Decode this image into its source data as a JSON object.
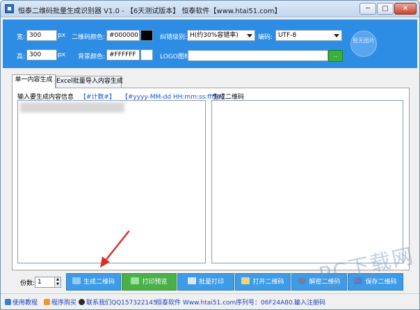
{
  "window": {
    "title": "恒泰二维码批量生成识别器 V1.0 - 【6天测试版本】 恒泰软件【www.htai51.com】",
    "min_symbol": "─",
    "max_symbol": "□",
    "close_symbol": "✕"
  },
  "settings": {
    "width_label": "宽:",
    "width_value": "300",
    "width_unit": "px",
    "height_label": "高:",
    "height_value": "300",
    "height_unit": "px",
    "qr_color_label": "二维码颜色:",
    "qr_color_value": "#000000",
    "qr_color_swatch": "#000000",
    "bg_color_label": "背景颜色:",
    "bg_color_value": "#FFFFFF",
    "bg_color_swatch": "#FFFFFF",
    "error_level_label": "纠错级别:",
    "error_level_value": "H(约30%容错率)",
    "encoding_label": "编码:",
    "encoding_value": "UTF-8",
    "logo_label": "LOGO图标:",
    "logo_value": "",
    "logo_button": "..",
    "logo_preview_text": "暂无图片"
  },
  "tabs": [
    {
      "label": "单一内容生成",
      "active": true
    },
    {
      "label": "Excel批量导入内容生成",
      "active": false
    }
  ],
  "input_panel": {
    "title": "输入要生成内容信息",
    "insert_counter": "【#计数#】",
    "insert_datetime": "【#yyyy-MM-dd HH:mm:ss:ffff#】",
    "text": ""
  },
  "output_panel": {
    "title": "生成二维码"
  },
  "toolbar": {
    "copies_label": "份数:",
    "copies_value": "1",
    "generate": "生成二维码",
    "print_preview": "打印预览",
    "batch_print": "批量打印",
    "open_qr": "打开二维码",
    "decode_qr": "解密二维码",
    "save_qr": "保存二维码"
  },
  "statusbar": {
    "tutorial": "使用教程",
    "purchase": "程序购买",
    "contact": "联系我们QQ157322145",
    "website": "恒泰软件 Www.htai51.com",
    "serial": "序列号：06F24A80...",
    "register": "输入注册码"
  },
  "watermark": {
    "text": "PC下载网",
    "url": "www.pc6.com"
  },
  "colors": {
    "settings_panel": "#2d8ce4",
    "blue_button": "#3d9be7",
    "green_button": "#49b04a",
    "arrow": "#d9302a"
  }
}
